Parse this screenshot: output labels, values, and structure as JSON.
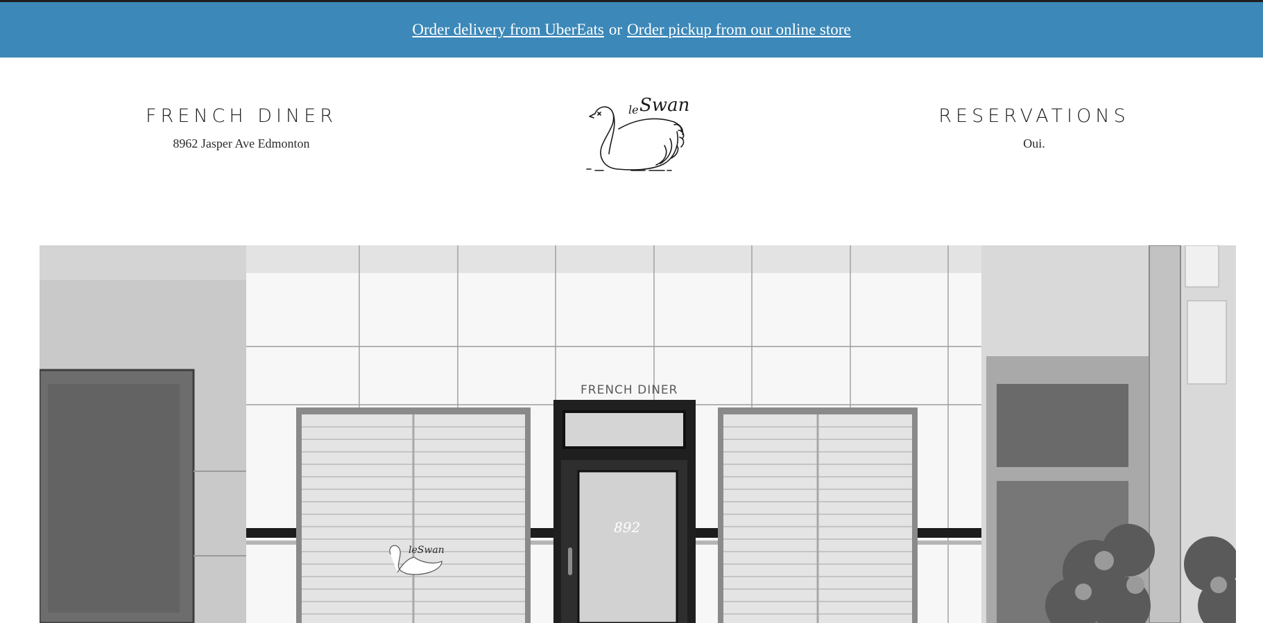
{
  "banner": {
    "delivery_link": "Order delivery from UberEats",
    "separator": "or",
    "pickup_link": "Order pickup from our online store",
    "bg_color": "#3c88b8"
  },
  "header": {
    "left": {
      "title": "FRENCH DINER",
      "subtitle": "8962 Jasper Ave Edmonton"
    },
    "right": {
      "title": "RESERVATIONS",
      "subtitle": "Oui."
    },
    "logo": {
      "text_le": "le",
      "text_swan": "Swan"
    }
  },
  "hero": {
    "storefront_sign": "FRENCH DINER",
    "door_number": "892",
    "window_logo": "leSwan"
  }
}
